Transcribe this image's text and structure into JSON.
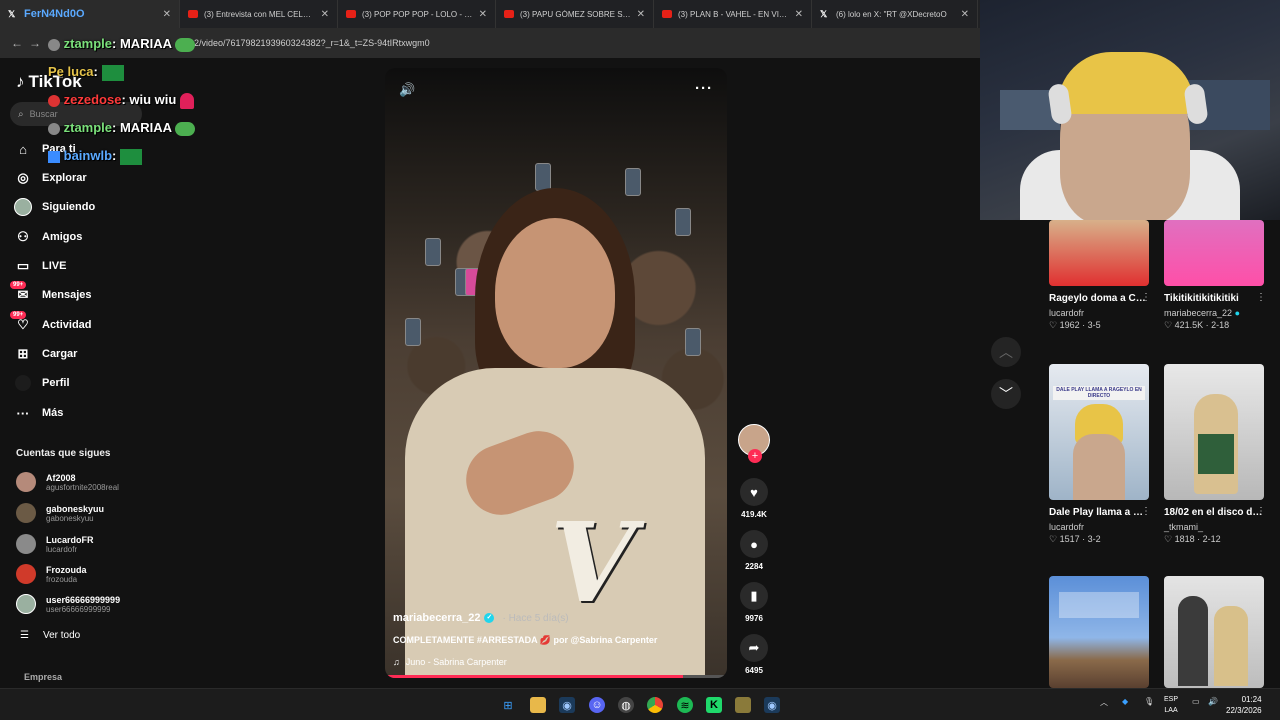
{
  "browser": {
    "tabs": [
      {
        "title": "FerN4Nd0O",
        "icon": "x-icon"
      },
      {
        "title": "(3) Entrevista con MEL CELESTE",
        "icon": "youtube-icon"
      },
      {
        "title": "(3) POP POP POP - LOLO - EN V",
        "icon": "youtube-icon"
      },
      {
        "title": "(3) PAPU GÓMEZ SOBRE SU DO",
        "icon": "youtube-icon"
      },
      {
        "title": "(3) PLAN B - VAHEL - EN VIVO",
        "icon": "youtube-icon"
      },
      {
        "title": "(6) lolo en X: \"RT @XDecretoO",
        "icon": "x-icon"
      }
    ],
    "url": "2/video/7617982193960324382?_r=1&_t=ZS-94tIRtxwgm0"
  },
  "chat": [
    {
      "user": "ztample",
      "user_color": "#7be07b",
      "text": ": MARIAA",
      "emote": "pepe"
    },
    {
      "user": "Pe luca",
      "user_color": "#e6c44a",
      "text": ":",
      "emote": "green-block"
    },
    {
      "user": "zezedose",
      "user_color": "#ff3b3b",
      "text": ": wiu wiu",
      "emote": "siren"
    },
    {
      "user": "ztample",
      "user_color": "#7be07b",
      "text": ": MARIAA",
      "emote": "pepe"
    },
    {
      "user": "bainwlb",
      "user_color": "#5aa9ff",
      "text": ":",
      "emote": "green-block"
    }
  ],
  "sidebar": {
    "logo": "TikTok",
    "search_placeholder": "Buscar",
    "nav": [
      {
        "label": "Para ti",
        "icon": "home-icon"
      },
      {
        "label": "Explorar",
        "icon": "compass-icon"
      },
      {
        "label": "Siguiendo",
        "icon": "following-avatar-icon"
      },
      {
        "label": "Amigos",
        "icon": "friends-icon"
      },
      {
        "label": "LIVE",
        "icon": "live-icon"
      },
      {
        "label": "Mensajes",
        "icon": "messages-icon",
        "badge": "99+"
      },
      {
        "label": "Actividad",
        "icon": "activity-icon",
        "badge": "99+"
      },
      {
        "label": "Cargar",
        "icon": "upload-icon"
      },
      {
        "label": "Perfil",
        "icon": "profile-icon"
      },
      {
        "label": "Más",
        "icon": "more-icon"
      }
    ],
    "following_header": "Cuentas que sigues",
    "accounts": [
      {
        "name": "Af2008",
        "handle": "agusfortnite2008real",
        "color": "#b58a7a"
      },
      {
        "name": "gaboneskyuu",
        "handle": "gaboneskyuu",
        "color": "#6b5a45"
      },
      {
        "name": "LucardoFR",
        "handle": "lucardofr",
        "color": "#8a8a8a"
      },
      {
        "name": "Frozouda",
        "handle": "frozouda",
        "color": "#d03a2a"
      },
      {
        "name": "user66666999999",
        "handle": "user66666999999",
        "color": "#9ab0a0"
      }
    ],
    "see_all": "Ver todo",
    "company": "Empresa"
  },
  "video": {
    "username": "mariabecerra_22",
    "time_ago": "· Hace 5 día(s)",
    "caption": "COMPLETAMENTE #ARRESTADA 💋 por @Sabrina Carpenter",
    "music": "Juno - Sabrina Carpenter",
    "progress": 0.87,
    "likes": "419.4K",
    "comments": "2284",
    "saves": "9976",
    "shares": "6495"
  },
  "grid": [
    {
      "title": "Rageylo doma a Coscu #rageylo...",
      "user": "lucardofr",
      "likes": "1962",
      "date": "3-5",
      "verified": false
    },
    {
      "title": "Tikitikitikitikitiki",
      "user": "mariabecerra_22",
      "likes": "421.5K",
      "date": "2-18",
      "verified": true
    },
    {
      "title": "Dale Play llama a Rageylo en direc...",
      "user": "lucardofr",
      "likes": "1517",
      "date": "3-2",
      "verified": false,
      "thumb_text": "DALE PLAY LLAMA A RAGEYLO EN DIRECTO"
    },
    {
      "title": "18/02 en el disco de @Slappy 🐱...",
      "user": "_tkmami_",
      "likes": "1818",
      "date": "2-12",
      "verified": false
    },
    {
      "title": "",
      "user": "",
      "likes": "",
      "date": "",
      "verified": false
    },
    {
      "title": "",
      "user": "",
      "likes": "",
      "date": "",
      "verified": false
    }
  ],
  "taskbar": {
    "lang_top": "ESP",
    "lang_bottom": "LAA",
    "time": "01:24",
    "date": "22/3/2026"
  },
  "colors": {
    "accent": "#fe2c55",
    "verified": "#20d5ec",
    "background": "#121212"
  }
}
